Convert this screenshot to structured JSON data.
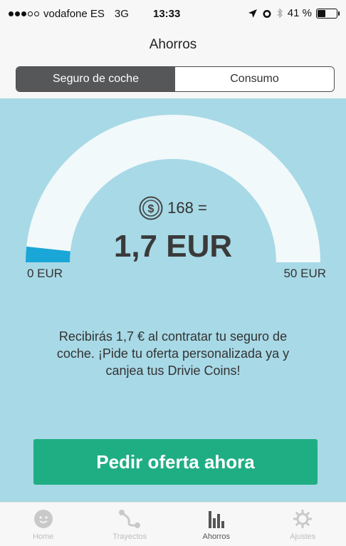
{
  "status_bar": {
    "carrier": "vodafone ES",
    "network": "3G",
    "time": "13:33",
    "battery": "41 %",
    "battery_level": 0.41
  },
  "header": {
    "title": "Ahorros"
  },
  "segments": [
    {
      "label": "Seguro de coche",
      "active": true
    },
    {
      "label": "Consumo",
      "active": false
    }
  ],
  "savings": {
    "coins": "168 =",
    "amount": "1,7 EUR",
    "min_label": "0 EUR",
    "max_label": "50 EUR",
    "progress_fraction": 0.034,
    "message": "Recibirás 1,7 € al contratar tu seguro de coche. ¡Pide tu oferta personalizada ya y canjea tus Drivie Coins!"
  },
  "cta": {
    "label": "Pedir oferta ahora"
  },
  "tabs": [
    {
      "label": "Home",
      "icon": "face-icon",
      "active": false
    },
    {
      "label": "Trayectos",
      "icon": "route-icon",
      "active": false
    },
    {
      "label": "Ahorros",
      "icon": "bar-chart-icon",
      "active": true
    },
    {
      "label": "Ajustes",
      "icon": "gear-icon",
      "active": false
    }
  ],
  "colors": {
    "panel": "#a8d9e6",
    "gauge_track": "#f2f9fb",
    "gauge_fill": "#1aa6d6",
    "cta": "#1fae83",
    "segment_active": "#555759"
  }
}
